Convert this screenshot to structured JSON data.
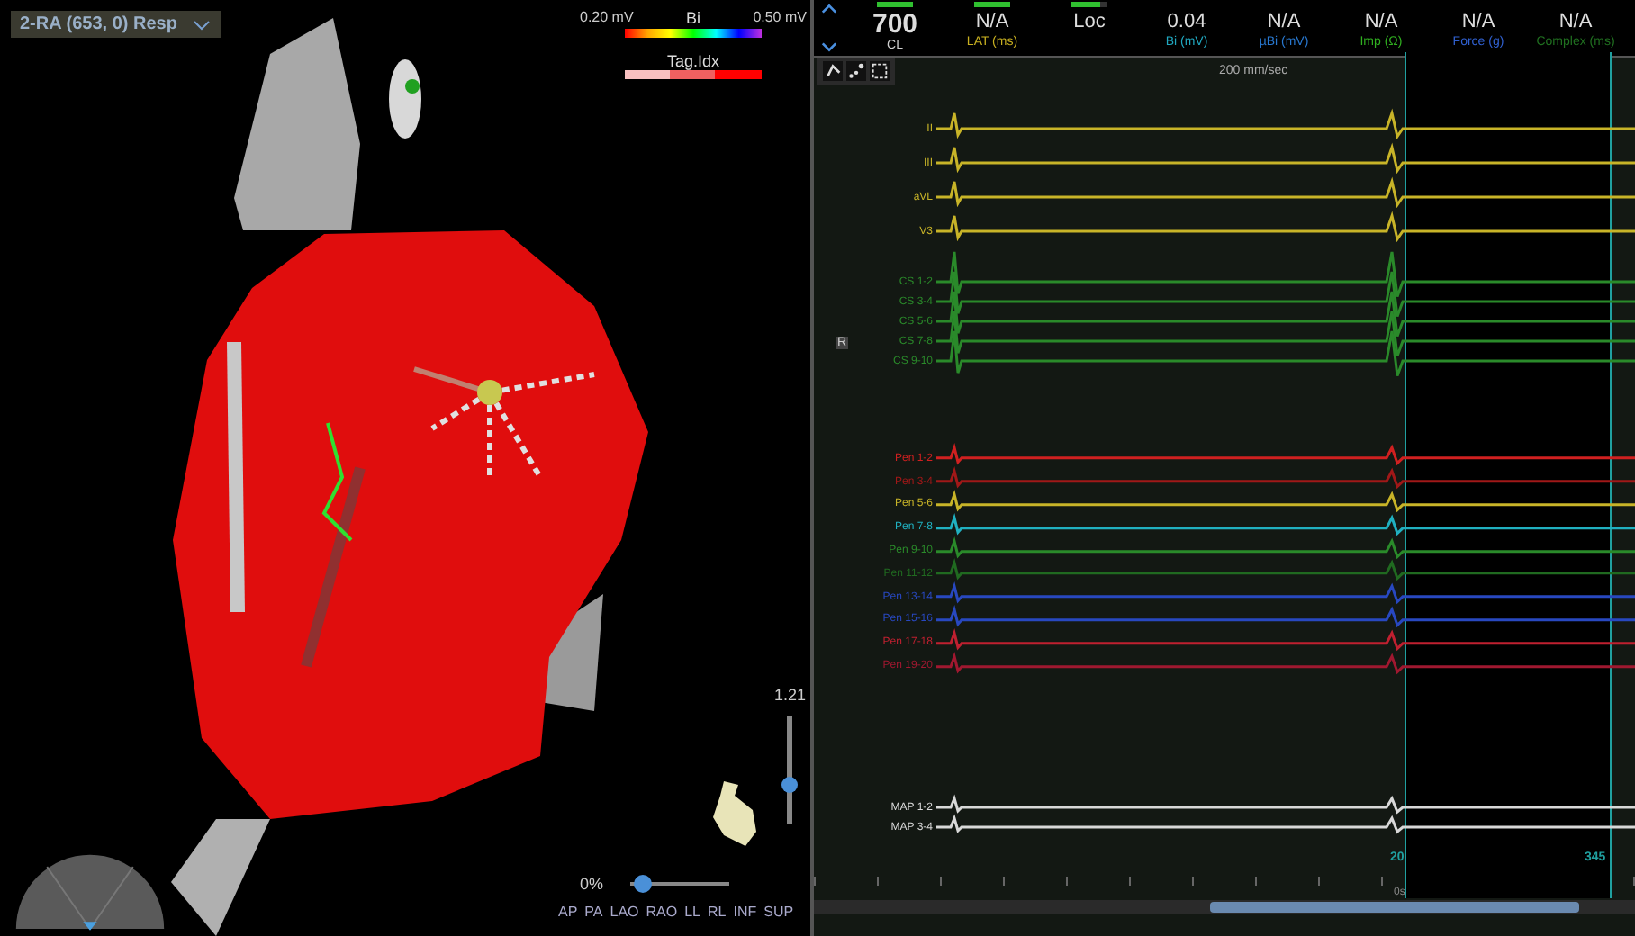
{
  "map_view": {
    "title": "2-RA (653, 0) Resp",
    "legend": {
      "min": "0.20 mV",
      "name": "Bi",
      "max": "0.50 mV"
    },
    "tag_legend": {
      "name": "Tag.Idx"
    },
    "zoom": {
      "value": "1.21",
      "level": 0.37
    },
    "opacity": {
      "value": "0%",
      "level": 0.12
    },
    "view_buttons": [
      "AP",
      "PA",
      "LAO",
      "RAO",
      "LL",
      "RL",
      "INF",
      "SUP"
    ]
  },
  "measurements": [
    {
      "value": "700",
      "caption": "CL",
      "color": "#d0d0d0",
      "level": 1
    },
    {
      "value": "N/A",
      "caption": "LAT (ms)",
      "color": "#c8b020",
      "level": 1
    },
    {
      "value": "Loc",
      "level": 0.8
    },
    {
      "value": "0.04",
      "caption": "Bi (mV)",
      "color": "#20a8c0"
    },
    {
      "value": "N/A",
      "caption": "µBi (mV)",
      "color": "#2878d0"
    },
    {
      "value": "N/A",
      "caption": "Imp (Ω)",
      "color": "#30b020"
    },
    {
      "value": "N/A",
      "caption": "Force (g)",
      "color": "#3060d0"
    },
    {
      "value": "N/A",
      "caption": "Complex (ms)",
      "color": "#207020"
    }
  ],
  "sweep_speed": "200 mm/sec",
  "channel_groups": [
    {
      "channels": [
        {
          "name": "II",
          "color": "#c8b428"
        },
        {
          "name": "III",
          "color": "#c8b428"
        },
        {
          "name": "aVL",
          "color": "#c8b428"
        },
        {
          "name": "V3",
          "color": "#c8b428"
        }
      ]
    },
    {
      "channels": [
        {
          "name": "CS 1-2",
          "color": "#2a8a2a"
        },
        {
          "name": "CS 3-4",
          "color": "#2a8a2a"
        },
        {
          "name": "CS 5-6",
          "color": "#2a8a2a"
        },
        {
          "name": "CS 7-8",
          "color": "#2a8a2a"
        },
        {
          "name": "CS 9-10",
          "color": "#2a8a2a"
        }
      ]
    },
    {
      "channels": [
        {
          "name": "Pen 1-2",
          "color": "#d02020"
        },
        {
          "name": "Pen 3-4",
          "color": "#a01818"
        },
        {
          "name": "Pen 5-6",
          "color": "#c8b428"
        },
        {
          "name": "Pen 7-8",
          "color": "#20b0c0"
        },
        {
          "name": "Pen 9-10",
          "color": "#2a8a2a"
        },
        {
          "name": "Pen 11-12",
          "color": "#206a20"
        },
        {
          "name": "Pen 13-14",
          "color": "#2848c0"
        },
        {
          "name": "Pen 15-16",
          "color": "#2848c0"
        },
        {
          "name": "Pen 17-18",
          "color": "#c02030"
        },
        {
          "name": "Pen 19-20",
          "color": "#a01830"
        }
      ]
    },
    {
      "channels": [
        {
          "name": "MAP 1-2",
          "color": "#d8d8d8"
        },
        {
          "name": "MAP 3-4",
          "color": "#d8d8d8"
        }
      ]
    }
  ],
  "annotation_badge": "R",
  "markers": [
    "20",
    "345"
  ],
  "time_label": "0s"
}
